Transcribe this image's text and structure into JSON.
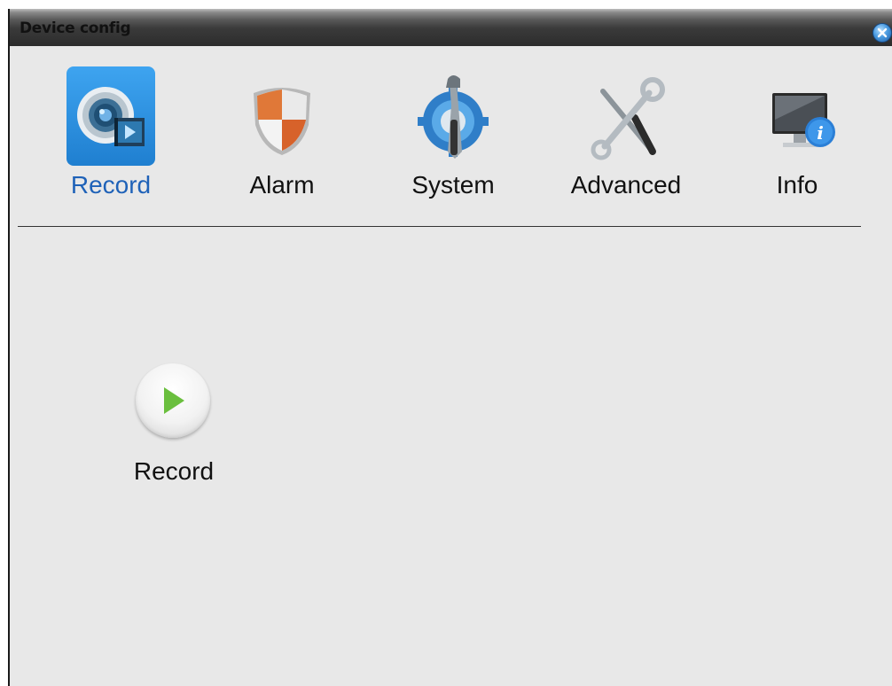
{
  "window": {
    "title": "Device config",
    "close_icon": "close-icon"
  },
  "tabs": [
    {
      "label": "Record",
      "icon": "record-camera-icon",
      "active": true
    },
    {
      "label": "Alarm",
      "icon": "alarm-shield-icon",
      "active": false
    },
    {
      "label": "System",
      "icon": "system-gear-icon",
      "active": false
    },
    {
      "label": "Advanced",
      "icon": "advanced-tools-icon",
      "active": false
    },
    {
      "label": "Info",
      "icon": "info-monitor-icon",
      "active": false
    }
  ],
  "content": {
    "items": [
      {
        "label": "Record",
        "icon": "play-icon"
      }
    ]
  },
  "colors": {
    "active_tab_text": "#1f62b8",
    "selected_icon_bg": "#2f8fe0",
    "play_arrow": "#6abf3e"
  }
}
